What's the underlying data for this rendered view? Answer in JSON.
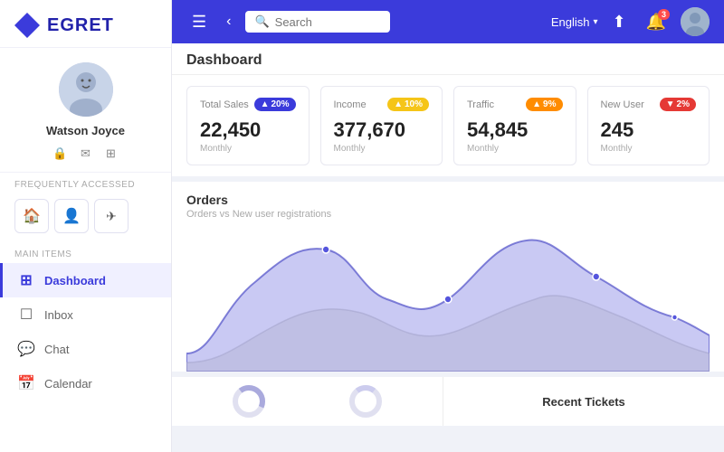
{
  "app": {
    "name": "EGRET"
  },
  "user": {
    "name": "Watson Joyce",
    "lock_icon": "🔒",
    "email_icon": "✉",
    "switch_icon": "⊞"
  },
  "sidebar": {
    "frequently_accessed_label": "Frequently Accessed",
    "main_items_label": "Main Items",
    "fav_items": [
      {
        "icon": "🏠",
        "label": "home"
      },
      {
        "icon": "👤",
        "label": "user"
      },
      {
        "icon": "✈",
        "label": "travel"
      }
    ],
    "nav_items": [
      {
        "label": "Dashboard",
        "icon": "⊞",
        "active": true
      },
      {
        "label": "Inbox",
        "icon": "□"
      },
      {
        "label": "Chat",
        "icon": "💬"
      },
      {
        "label": "Calendar",
        "icon": "📅"
      }
    ]
  },
  "topbar": {
    "search_placeholder": "Search",
    "language": "English",
    "notification_count": "3"
  },
  "dashboard": {
    "title": "Dashboard",
    "stats": [
      {
        "label": "Total Sales",
        "badge": "20%",
        "badge_type": "blue",
        "value": "22,450",
        "period": "Monthly"
      },
      {
        "label": "Income",
        "badge": "10%",
        "badge_type": "yellow",
        "value": "377,670",
        "period": "Monthly"
      },
      {
        "label": "Traffic",
        "badge": "9%",
        "badge_type": "orange",
        "value": "54,845",
        "period": "Monthly"
      },
      {
        "label": "New User",
        "badge": "2%",
        "badge_type": "red",
        "value": "245",
        "period": "Monthly"
      }
    ],
    "chart": {
      "title": "Orders",
      "subtitle": "Orders vs New user registrations"
    },
    "recent_tickets_label": "Recent Tickets"
  }
}
